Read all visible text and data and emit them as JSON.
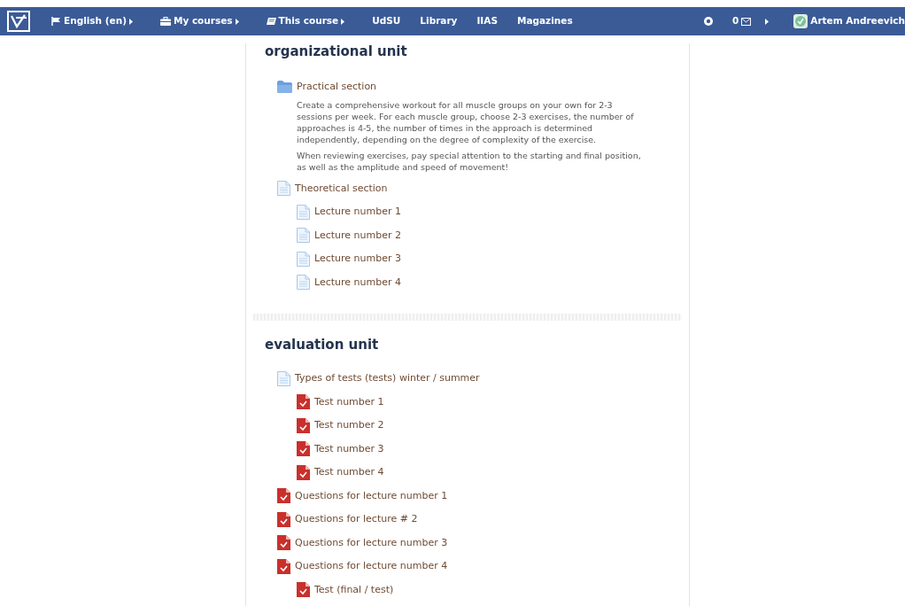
{
  "navbar": {
    "menus": [
      {
        "kind": "dropdown",
        "label": "English (en)"
      },
      {
        "kind": "dropdown",
        "label": "My courses"
      },
      {
        "kind": "dropdown",
        "label": "This course"
      },
      {
        "kind": "link",
        "label": "UdSU"
      },
      {
        "kind": "link",
        "label": "Library"
      },
      {
        "kind": "link",
        "label": "IIAS"
      },
      {
        "kind": "link",
        "label": "Magazines"
      }
    ],
    "message_count": "0",
    "user_name": "Artem Andreevich"
  },
  "sections": [
    {
      "title": "organizational unit",
      "items": [
        {
          "kind": "folder",
          "label": "Practical section",
          "description": [
            "Create a comprehensive workout for all muscle groups on your own for 2-3 sessions per week. For each muscle group, choose 2-3 exercises, the number of approaches is 4-5, the number of times in the approach is determined independently, depending on the degree of complexity of the exercise.",
            "When reviewing exercises, pay special attention to the starting and final position, as well as the amplitude and speed of movement!"
          ]
        },
        {
          "kind": "page",
          "label": "Theoretical section",
          "children": [
            {
              "kind": "page",
              "label": "Lecture number 1"
            },
            {
              "kind": "page",
              "label": "Lecture number 2"
            },
            {
              "kind": "page",
              "label": "Lecture number 3"
            },
            {
              "kind": "page",
              "label": "Lecture number 4"
            }
          ]
        }
      ]
    },
    {
      "title": "evaluation unit",
      "items": [
        {
          "kind": "page",
          "label": "Types of tests (tests) winter / summer",
          "children": [
            {
              "kind": "quiz",
              "label": "Test number 1"
            },
            {
              "kind": "quiz",
              "label": "Test number 2"
            },
            {
              "kind": "quiz",
              "label": "Test number 3"
            },
            {
              "kind": "quiz",
              "label": "Test number 4"
            }
          ]
        },
        {
          "kind": "quiz",
          "label": "Questions for lecture number 1"
        },
        {
          "kind": "quiz",
          "label": "Questions for lecture # 2"
        },
        {
          "kind": "quiz",
          "label": "Questions for lecture number 3"
        },
        {
          "kind": "quiz",
          "label": "Questions for lecture number 4",
          "children": [
            {
              "kind": "quiz",
              "label": "Test (final / test)"
            }
          ]
        }
      ]
    }
  ]
}
